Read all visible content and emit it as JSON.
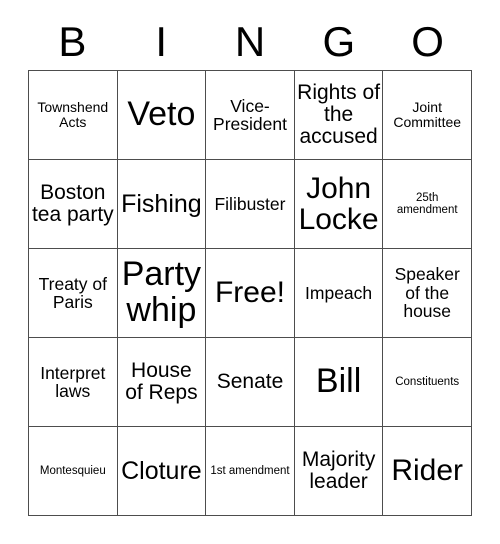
{
  "card": {
    "title_letters": [
      "B",
      "I",
      "N",
      "G",
      "O"
    ],
    "columns": 5,
    "rows": 5,
    "colors": {
      "background": "#ffffff",
      "text": "#000000",
      "grid_line": "#4d4d4d"
    },
    "cells": [
      {
        "text": "Townshend Acts",
        "size": "fs-s",
        "free": false
      },
      {
        "text": "Veto",
        "size": "fs-xxxl",
        "free": false
      },
      {
        "text": "Vice-President",
        "size": "fs-m",
        "free": false
      },
      {
        "text": "Rights of the accused",
        "size": "fs-l",
        "free": false
      },
      {
        "text": "Joint Committee",
        "size": "fs-s",
        "free": false
      },
      {
        "text": "Boston tea party",
        "size": "fs-l",
        "free": false
      },
      {
        "text": "Fishing",
        "size": "fs-xl",
        "free": false
      },
      {
        "text": "Filibuster",
        "size": "fs-m",
        "free": false
      },
      {
        "text": "John Locke",
        "size": "fs-xxl",
        "free": false
      },
      {
        "text": "25th amendment",
        "size": "fs-xs",
        "free": false
      },
      {
        "text": "Treaty of Paris",
        "size": "fs-m",
        "free": false
      },
      {
        "text": "Party whip",
        "size": "fs-xxxl",
        "free": false
      },
      {
        "text": "Free!",
        "size": "fs-xxl",
        "free": true
      },
      {
        "text": "Impeach",
        "size": "fs-m",
        "free": false
      },
      {
        "text": "Speaker of the house",
        "size": "fs-m",
        "free": false
      },
      {
        "text": "Interpret laws",
        "size": "fs-m",
        "free": false
      },
      {
        "text": "House of Reps",
        "size": "fs-l",
        "free": false
      },
      {
        "text": "Senate",
        "size": "fs-l",
        "free": false
      },
      {
        "text": "Bill",
        "size": "fs-xxxl",
        "free": false
      },
      {
        "text": "Constituents",
        "size": "fs-xs",
        "free": false
      },
      {
        "text": "Montesquieu",
        "size": "fs-xs",
        "free": false
      },
      {
        "text": "Cloture",
        "size": "fs-xl",
        "free": false
      },
      {
        "text": "1st amendment",
        "size": "fs-xs",
        "free": false
      },
      {
        "text": "Majority leader",
        "size": "fs-l",
        "free": false
      },
      {
        "text": "Rider",
        "size": "fs-xxl",
        "free": false
      }
    ]
  }
}
